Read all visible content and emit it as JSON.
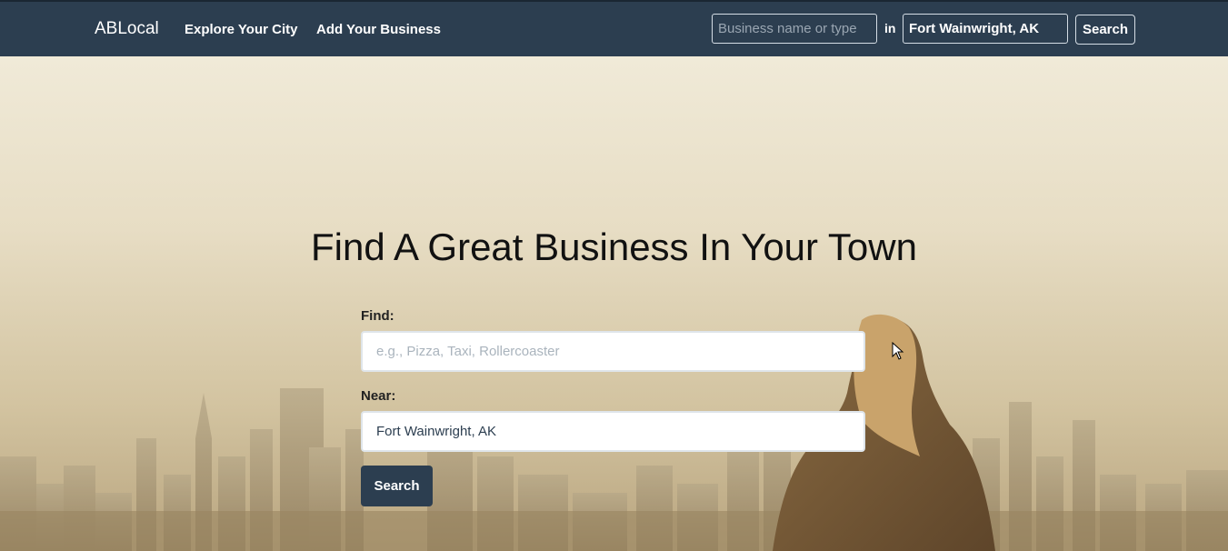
{
  "nav": {
    "brand": "ABLocal",
    "links": [
      "Explore Your City",
      "Add Your Business"
    ],
    "search_placeholder": "Business name or type",
    "in_label": "in",
    "location_value": "Fort Wainwright, AK",
    "search_button": "Search"
  },
  "hero": {
    "title": "Find A Great Business In Your Town",
    "find_label": "Find:",
    "find_placeholder": "e.g., Pizza, Taxi, Rollercoaster",
    "near_label": "Near:",
    "near_value": "Fort Wainwright, AK",
    "search_button": "Search"
  },
  "colors": {
    "navbar": "#2c3e50",
    "accent_button": "#2c3e50",
    "hero_tint": "#e7ddc4"
  }
}
